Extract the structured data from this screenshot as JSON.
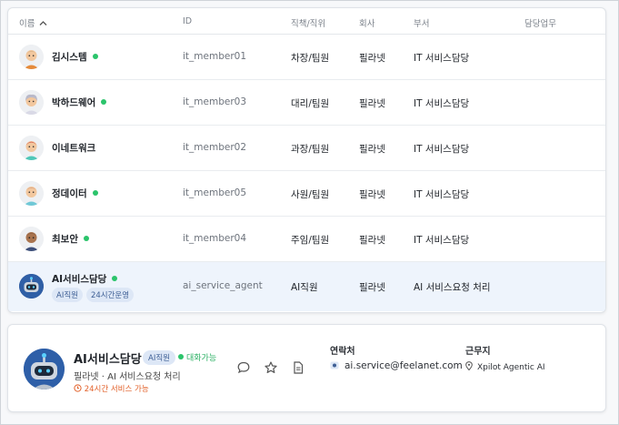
{
  "table": {
    "headers": {
      "name": "이름",
      "id": "ID",
      "position": "직책/직위",
      "company": "회사",
      "department": "부서",
      "duty": "담당업무"
    },
    "rows": [
      {
        "name": "김시스템",
        "id": "it_member01",
        "position": "차장/팀원",
        "company": "필라넷",
        "department": "IT 서비스담당",
        "online": true
      },
      {
        "name": "박하드웨어",
        "id": "it_member03",
        "position": "대리/팀원",
        "company": "필라넷",
        "department": "IT 서비스담당",
        "online": true
      },
      {
        "name": "이네트워크",
        "id": "it_member02",
        "position": "과장/팀원",
        "company": "필라넷",
        "department": "IT 서비스담당",
        "online": false
      },
      {
        "name": "정데이터",
        "id": "it_member05",
        "position": "사원/팀원",
        "company": "필라넷",
        "department": "IT 서비스담당",
        "online": true
      },
      {
        "name": "최보안",
        "id": "it_member04",
        "position": "주임/팀원",
        "company": "필라넷",
        "department": "IT 서비스담당",
        "online": true
      }
    ],
    "agent_row": {
      "name": "AI서비스담당",
      "tags": [
        "AI직원",
        "24시간운영"
      ],
      "id": "ai_service_agent",
      "position": "AI직원",
      "company": "필라넷",
      "department": "AI 서비스요청 처리",
      "online": true
    }
  },
  "profile": {
    "name": "AI서비스담당",
    "badge": "AI직원",
    "status": "대화가능",
    "subtitle": "필라넷 · AI 서비스요청 처리",
    "hours": "24시간 서비스 가능",
    "contact_label": "연락처",
    "contact_value": "ai.service@feelanet.com",
    "location_label": "근무지",
    "location_value": "Xpilot Agentic AI"
  },
  "colors": {
    "online": "#2bc46b",
    "accent": "#3e5f95",
    "warning": "#e2612a",
    "selected_row": "#eef4fc"
  },
  "icons": [
    "sort-up-icon",
    "chat-icon",
    "star-icon",
    "document-icon",
    "mail-icon",
    "location-pin-icon",
    "clock-icon"
  ]
}
